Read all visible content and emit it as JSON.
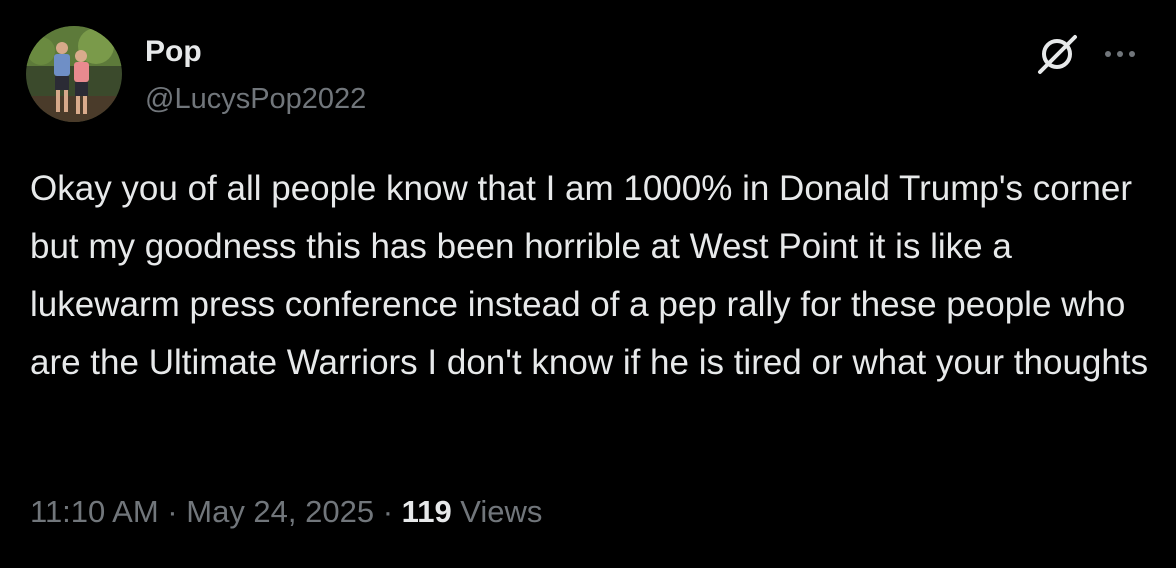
{
  "author": {
    "display_name": "Pop",
    "handle": "@LucysPop2022",
    "avatar_icon": "profile-photo"
  },
  "actions": {
    "grok_icon": "grok-icon",
    "more_icon": "more-icon"
  },
  "tweet": {
    "text": "Okay you of all people know that I am 1000% in Donald Trump's corner but my goodness this has been horrible at West Point it is like a lukewarm press conference instead of a pep rally for these people who are the Ultimate Warriors I don't know if he is tired or what your thoughts"
  },
  "meta": {
    "time": "11:10 AM",
    "separator1": " · ",
    "date": "May 24, 2025",
    "separator2": " · ",
    "views_count": "119",
    "views_label": " Views"
  },
  "colors": {
    "background": "#000000",
    "primary_text": "#e7e9ea",
    "secondary_text": "#71767b"
  }
}
